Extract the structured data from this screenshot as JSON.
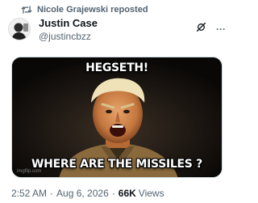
{
  "repost": {
    "text": "Nicole Grajewski reposted",
    "icon": "repost-icon"
  },
  "author": {
    "name": "Justin Case",
    "handle": "@justincbzz",
    "avatar_icon": "avatar-image"
  },
  "actions": {
    "grok_icon": "grok-icon",
    "more_icon": "more-icon",
    "more_label": "···"
  },
  "media": {
    "caption_top": "HEGSETH!",
    "caption_bottom": "WHERE ARE THE MISSILES ?",
    "watermark": "imgflip.com"
  },
  "meta": {
    "time": "2:52 AM",
    "date": "Aug 6, 2026",
    "separator": "·",
    "views_count": "66K",
    "views_label": "Views"
  }
}
